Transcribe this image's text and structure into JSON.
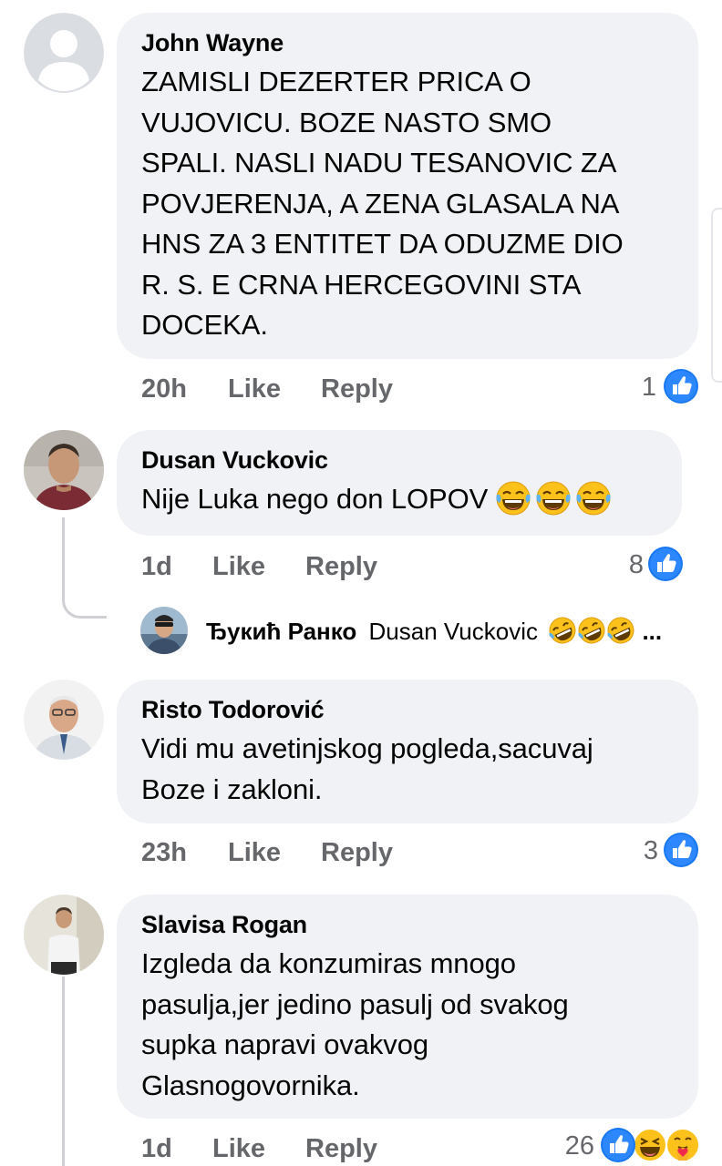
{
  "comments": [
    {
      "author": "John Wayne",
      "lines": [
        "ZAMISLI DEZERTER PRICA O",
        "VUJOVICU. BOZE NASTO SMO",
        "SPALI. NASLI NADU TESANOVIC ZA",
        "POVJERENJA, A ZENA GLASALA NA",
        "HNS ZA 3 ENTITET DA ODUZME DIO",
        "R. S. E CRNA HERCEGOVINI STA",
        "DOCEKA."
      ],
      "time": "20h",
      "like": "Like",
      "reply": "Reply",
      "reaction_count": "1",
      "reactions": [
        "like-icon"
      ]
    },
    {
      "author": "Dusan Vuckovic",
      "lines": [
        "Nije Luka nego don LOPOV"
      ],
      "time": "1d",
      "like": "Like",
      "reply": "Reply",
      "reaction_count": "8",
      "reactions": [
        "like-icon"
      ],
      "text_emojis": [
        "laugh-cry-emoji",
        "laugh-cry-emoji",
        "laugh-cry-emoji"
      ]
    },
    {
      "author": "Risto Todorović",
      "lines": [
        "Vidi mu avetinjskog pogleda,sacuvaj",
        "Boze i zakloni."
      ],
      "time": "23h",
      "like": "Like",
      "reply": "Reply",
      "reaction_count": "3",
      "reactions": [
        "like-icon"
      ]
    },
    {
      "author": "Slavisa Rogan",
      "lines": [
        "Izgleda da konzumiras mnogo",
        "pasulja,jer jedino pasulj od svakog",
        "supka napravi ovakvog",
        "Glasnogovornika."
      ],
      "time": "1d",
      "like": "Like",
      "reply": "Reply",
      "reaction_count": "26",
      "reactions": [
        "like-icon",
        "haha-icon",
        "care-icon"
      ]
    }
  ],
  "reply_preview": {
    "author": "Ђукић Ранко",
    "mention": "Dusan Vuckovic",
    "emojis": [
      "rolling-laugh-emoji",
      "rolling-laugh-emoji",
      "rolling-laugh-emoji"
    ],
    "ellipsis": "..."
  },
  "colors": {
    "bubble": "#f0f2f5",
    "meta_text": "#65676b",
    "like_blue": "#1877f2",
    "thread_line": "#ced0d4"
  }
}
